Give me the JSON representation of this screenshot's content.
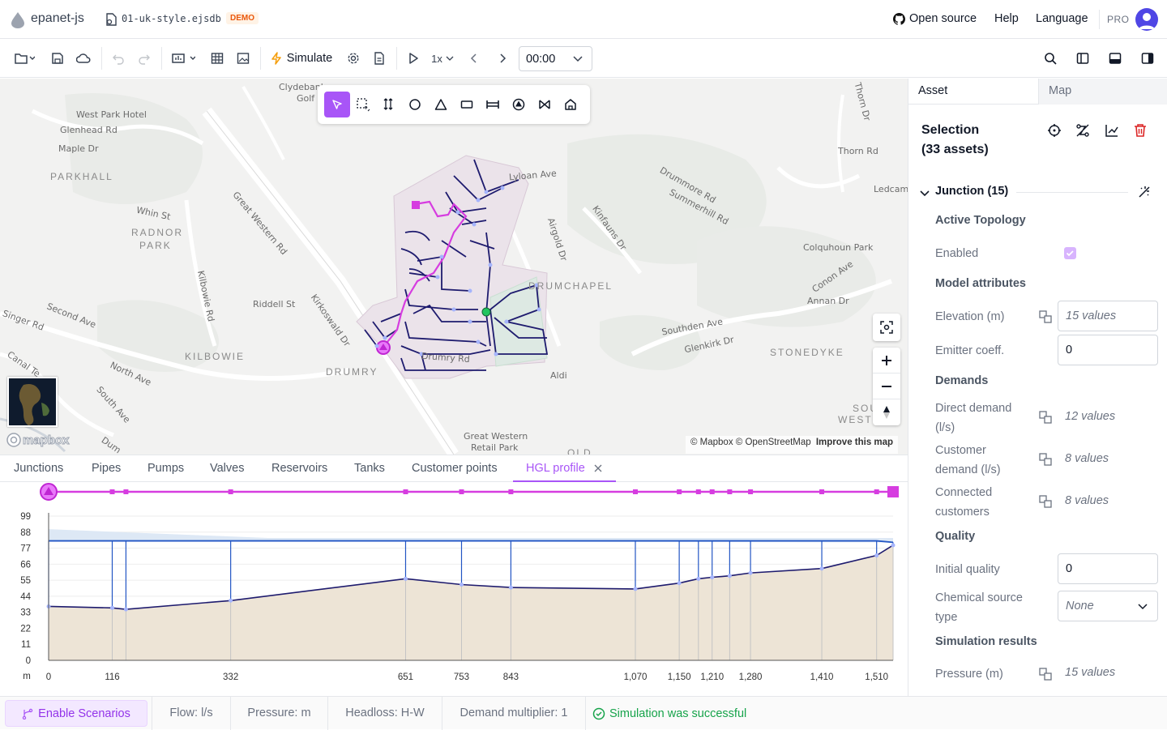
{
  "app": {
    "name": "epanet-js",
    "file_name": "01-uk-style.ejsdb",
    "badge": "DEMO"
  },
  "header_links": {
    "open_source": "Open source",
    "help": "Help",
    "language": "Language",
    "plan": "PRO"
  },
  "toolbar": {
    "simulate": "Simulate",
    "speed": "1x",
    "time": "00:00"
  },
  "map": {
    "attribution_mapbox": "© Mapbox",
    "attribution_osm": "© OpenStreetMap",
    "improve": "Improve this map",
    "logo_text": "mapbox",
    "labels": {
      "west_park_hotel": "West Park Hotel",
      "glenhead_rd": "Glenhead Rd",
      "maple_dr": "Maple Dr",
      "parkhall": "PARKHALL",
      "whin_st": "Whin St",
      "radnor": "RADNOR",
      "park": "PARK",
      "great_western_rd": "Great Western Rd",
      "kilbowie_rd": "Kilbowie Rd",
      "riddell_st": "Riddell St",
      "singer_rd": "Singer Rd",
      "second_ave": "Second Ave",
      "canal_ter": "Canal Te",
      "kilbowie": "KILBOWIE",
      "drumry": "DRUMRY",
      "north_ave": "North Ave",
      "south_ave": "South Ave",
      "kirkoswald_dr": "Kirkoswald Dr",
      "clydebank_golf": "Clydebank",
      "golf": "Golf",
      "lyloan_ave": "Lyloan Ave",
      "drumry_rd": "Drumry Rd",
      "airgold_dr": "Airgold Dr",
      "kinfauns_dr": "Kinfauns Dr",
      "drummore_rd": "Drummore Rd",
      "summerhill_rd": "Summerhill Rd",
      "drumchapel": "DRUMCHAPEL",
      "thorn_dr": "Thorn Dr",
      "thorn_rd": "Thorn Rd",
      "ledcame": "Ledcame",
      "colquhoun_park": "Colquhoun Park",
      "conon_ave": "Conon Ave",
      "annan_dr": "Annan Dr",
      "southden_ave": "Southden Ave",
      "glenkirk_dr": "Glenkirk Dr",
      "stonedyke": "STONEDYKE",
      "aldi": "Aldi",
      "great_western_retail": "Great Western",
      "retail_park": "Retail Park",
      "sou": "SOU",
      "weste": "WESTE",
      "old": "OLD",
      "dum": "Dum"
    }
  },
  "bottom_tabs": [
    "Junctions",
    "Pipes",
    "Pumps",
    "Valves",
    "Reservoirs",
    "Tanks",
    "Customer points",
    "HGL profile"
  ],
  "active_tab": "HGL profile",
  "chart_data": {
    "type": "area",
    "title": "",
    "xlabel": "m",
    "ylabel": "",
    "x_ticks": [
      0,
      116,
      332,
      651,
      753,
      843,
      1070,
      1150,
      1210,
      1280,
      1410,
      1510
    ],
    "x_tick_labels": [
      "0",
      "116",
      "332",
      "651",
      "753",
      "843",
      "1,070",
      "1,150",
      "1,210",
      "1,280",
      "1,410",
      "1,510"
    ],
    "y_ticks": [
      0,
      11,
      22,
      33,
      44,
      55,
      66,
      77,
      88,
      99
    ],
    "xlim": [
      0,
      1540
    ],
    "ylim": [
      0,
      99
    ],
    "series": [
      {
        "x": [
          0,
          116,
          141,
          332,
          651,
          753,
          843,
          1070,
          1150,
          1185,
          1210,
          1242,
          1280,
          1410,
          1510,
          1540
        ],
        "values": [
          82,
          82,
          82,
          82,
          82,
          82,
          82,
          82,
          82,
          82,
          82,
          82,
          82,
          82,
          82,
          81
        ]
      },
      {
        "x": [
          0,
          116,
          141,
          332,
          651,
          753,
          843,
          1070,
          1150,
          1185,
          1210,
          1242,
          1280,
          1410,
          1510,
          1540
        ],
        "values": [
          37,
          36,
          35,
          41,
          56,
          52,
          50,
          49,
          53,
          56,
          57,
          58,
          60,
          63,
          72,
          79
        ]
      }
    ],
    "colors": {
      "hgl": "#2255c4",
      "ground_line": "#1e1b6e",
      "ground_fill": "#ede4d6",
      "band": "#dde8f5"
    }
  },
  "right_panel": {
    "tabs": [
      "Asset",
      "Map"
    ],
    "selection_title": "Selection",
    "selection_count": "(33 assets)",
    "junction_header": "Junction (15)",
    "active_topology": "Active Topology",
    "enabled": "Enabled",
    "model_attributes": "Model attributes",
    "elevation_label": "Elevation (m)",
    "elevation_value": "15 values",
    "emitter_label": "Emitter coeff.",
    "emitter_value": "0",
    "demands": "Demands",
    "direct_demand_label_1": "Direct demand",
    "direct_demand_label_2": "(l/s)",
    "direct_demand_value": "12 values",
    "customer_demand_label_1": "Customer",
    "customer_demand_label_2": "demand (l/s)",
    "customer_demand_value": "8 values",
    "connected_label_1": "Connected",
    "connected_label_2": "customers",
    "connected_value": "8 values",
    "quality": "Quality",
    "initial_quality_label": "Initial quality",
    "initial_quality_value": "0",
    "chemical_label_1": "Chemical source",
    "chemical_label_2": "type",
    "chemical_value": "None",
    "simulation_results": "Simulation results",
    "pressure_label": "Pressure (m)",
    "pressure_value": "15 values"
  },
  "status": {
    "scenarios": "Enable Scenarios",
    "flow": "Flow: l/s",
    "pressure": "Pressure: m",
    "headloss": "Headloss: H-W",
    "demand": "Demand multiplier: 1",
    "sim": "Simulation was successful"
  },
  "colors": {
    "accent": "#a855f7",
    "magenta": "#d63de0",
    "network": "#1e1b6e",
    "success": "#16a34a",
    "danger": "#dc2626"
  }
}
